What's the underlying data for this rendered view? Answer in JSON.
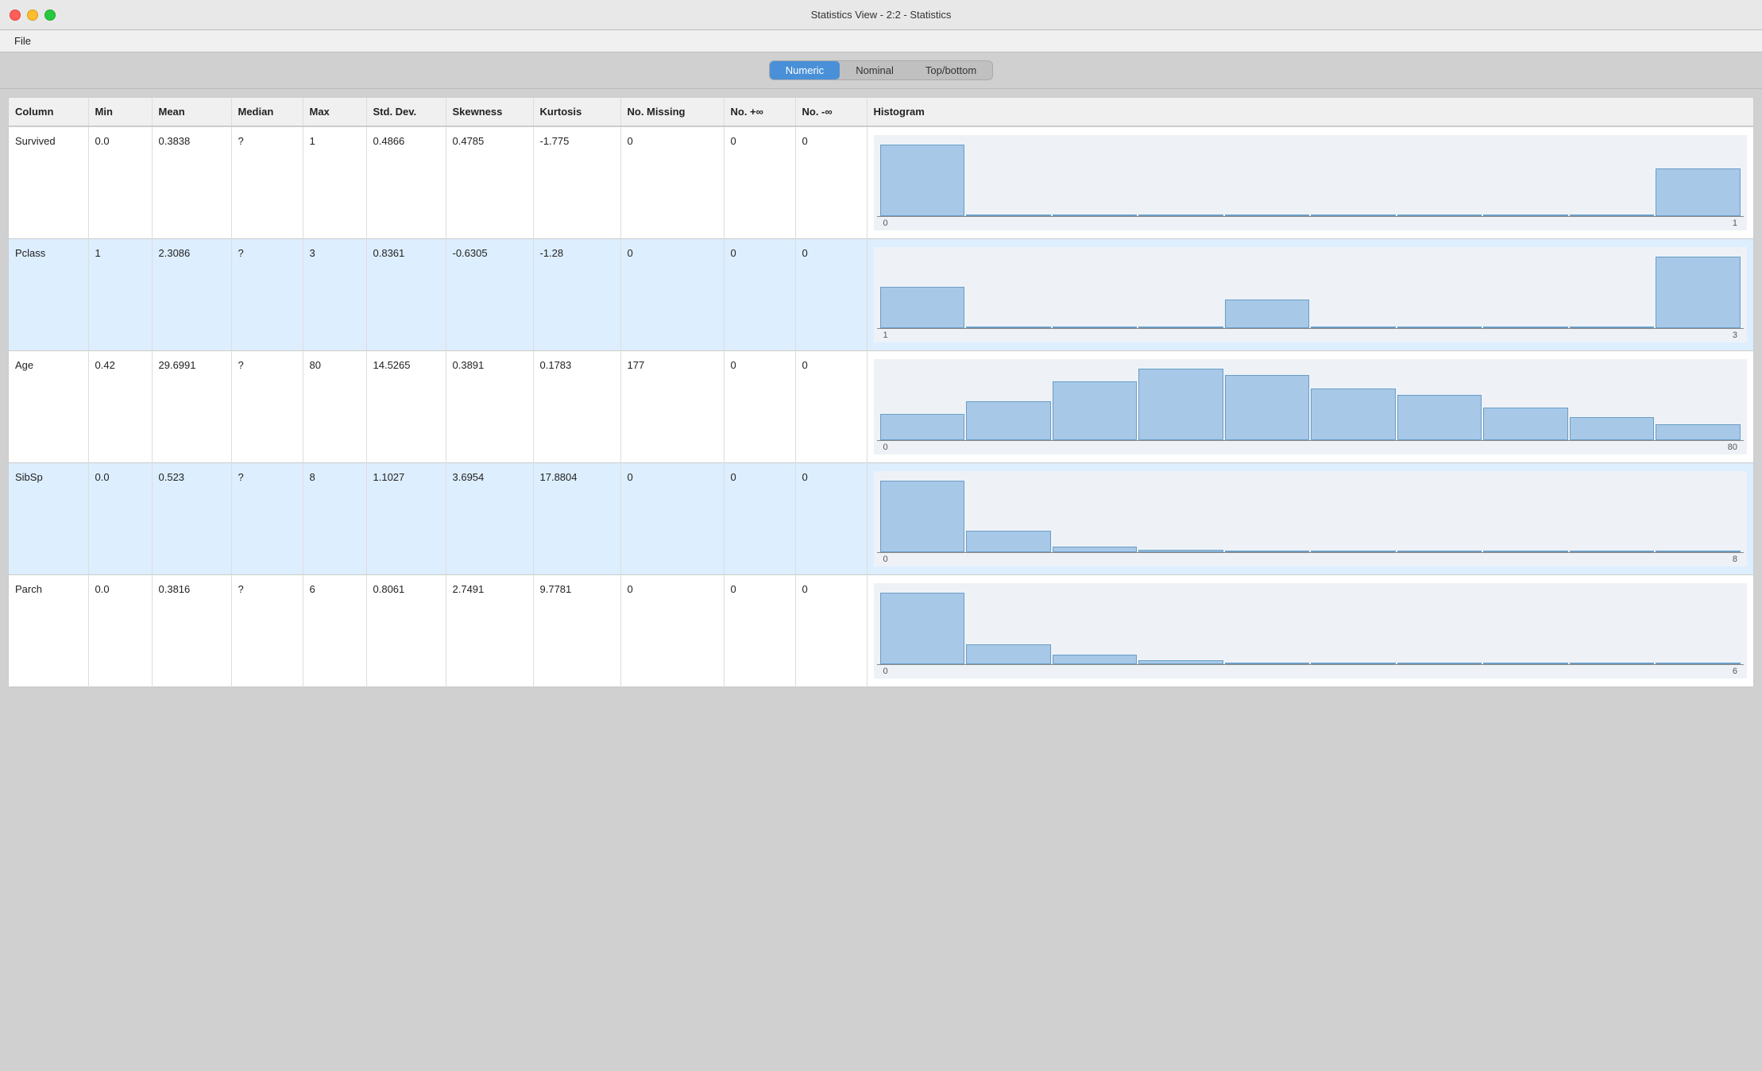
{
  "window": {
    "title": "Statistics View - 2:2 - Statistics"
  },
  "menubar": {
    "items": [
      "File"
    ]
  },
  "tabs": [
    {
      "id": "numeric",
      "label": "Numeric",
      "active": true
    },
    {
      "id": "nominal",
      "label": "Nominal",
      "active": false
    },
    {
      "id": "topbottom",
      "label": "Top/bottom",
      "active": false
    }
  ],
  "table": {
    "headers": [
      "Column",
      "Min",
      "Mean",
      "Median",
      "Max",
      "Std. Dev.",
      "Skewness",
      "Kurtosis",
      "No. Missing",
      "No. +∞",
      "No. -∞",
      "Histogram"
    ],
    "rows": [
      {
        "column": "Survived",
        "min": "0.0",
        "mean": "0.3838",
        "median": "?",
        "max": "1",
        "stddev": "0.4866",
        "skewness": "0.4785",
        "kurtosis": "-1.775",
        "missing": "0",
        "posinf": "0",
        "neginf": "0",
        "hist_min": "0",
        "hist_max": "1",
        "hist_bars": [
          45,
          0,
          0,
          0,
          0,
          0,
          0,
          0,
          0,
          30
        ]
      },
      {
        "column": "Pclass",
        "min": "1",
        "mean": "2.3086",
        "median": "?",
        "max": "3",
        "stddev": "0.8361",
        "skewness": "-0.6305",
        "kurtosis": "-1.28",
        "missing": "0",
        "posinf": "0",
        "neginf": "0",
        "hist_min": "1",
        "hist_max": "3",
        "hist_bars": [
          22,
          0,
          0,
          0,
          15,
          0,
          0,
          0,
          0,
          38
        ]
      },
      {
        "column": "Age",
        "min": "0.42",
        "mean": "29.6991",
        "median": "?",
        "max": "80",
        "stddev": "14.5265",
        "skewness": "0.3891",
        "kurtosis": "0.1783",
        "missing": "177",
        "posinf": "0",
        "neginf": "0",
        "hist_min": "0",
        "hist_max": "80",
        "hist_bars": [
          8,
          12,
          18,
          22,
          20,
          16,
          14,
          10,
          7,
          5
        ]
      },
      {
        "column": "SibSp",
        "min": "0.0",
        "mean": "0.523",
        "median": "?",
        "max": "8",
        "stddev": "1.1027",
        "skewness": "3.6954",
        "kurtosis": "17.8804",
        "missing": "0",
        "posinf": "0",
        "neginf": "0",
        "hist_min": "0",
        "hist_max": "8",
        "hist_bars": [
          60,
          18,
          5,
          2,
          1,
          1,
          0,
          0,
          0,
          1
        ]
      },
      {
        "column": "Parch",
        "min": "0.0",
        "mean": "0.3816",
        "median": "?",
        "max": "6",
        "stddev": "0.8061",
        "skewness": "2.7491",
        "kurtosis": "9.7781",
        "missing": "0",
        "posinf": "0",
        "neginf": "0",
        "hist_min": "0",
        "hist_max": "6",
        "hist_bars": [
          58,
          16,
          8,
          3,
          1,
          1,
          0,
          0,
          0,
          0
        ]
      }
    ]
  }
}
